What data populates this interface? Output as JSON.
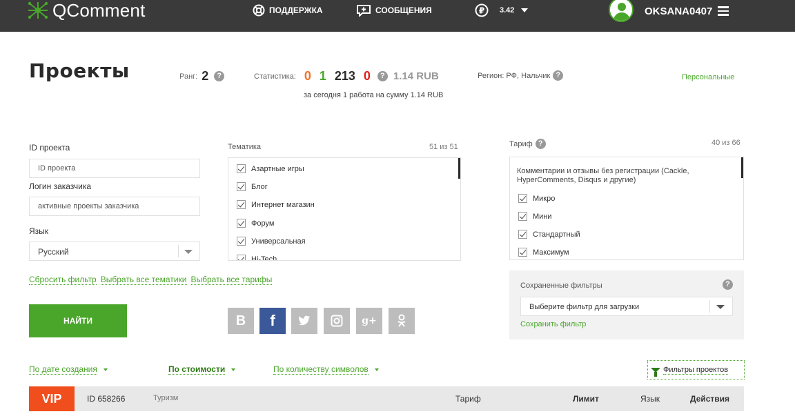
{
  "brand": {
    "name": "QComment"
  },
  "nav": {
    "support": "ПОДДЕРЖКА",
    "messages": "СООБЩЕНИЯ",
    "balance": "3.42"
  },
  "user": {
    "name": "OKSANA0407"
  },
  "header": {
    "title": "Проекты",
    "rank_label": "Ранг:",
    "rank_value": "2",
    "stats_label": "Статистика:",
    "stats": [
      "0",
      "1",
      "213",
      "0"
    ],
    "stats_rub": "1.14 RUB",
    "today": "за сегодня 1 работа на сумму 1.14 RUB",
    "region": "Регион: РФ, Нальчик",
    "personal": "Персональные"
  },
  "filters": {
    "project_id_label": "ID проекта",
    "project_id_placeholder": "ID проекта",
    "customer_label": "Логин заказчика",
    "customer_placeholder": "активные проекты заказчика",
    "lang_label": "Язык",
    "lang_value": "Русский",
    "links": [
      "Сбросить фильтр",
      "Выбрать все тематики",
      "Выбрать все тарифы"
    ],
    "find": "НАЙТИ"
  },
  "topics": {
    "title": "Тематика",
    "count": "51 из 51",
    "items": [
      "Азартные игры",
      "Блог",
      "Интернет магазин",
      "Форум",
      "Универсальная",
      "Hi-Tech"
    ]
  },
  "tariff": {
    "title": "Тариф",
    "count": "40 из 66",
    "group": "Комментарии и отзывы без регистрации (Cackle, HyperComments, Disqus и другие)",
    "items": [
      "Микро",
      "Мини",
      "Стандартный",
      "Максимум"
    ]
  },
  "social": [
    "B",
    "f",
    "t",
    "ig",
    "g+",
    "ok"
  ],
  "saved_filters": {
    "title": "Сохраненные фильтры",
    "select": "Выберите фильтр для загрузки",
    "save": "Сохранить фильтр"
  },
  "sort": {
    "by_date": "По дате создания",
    "by_cost": "По стоимости",
    "by_chars": "По количеству символов",
    "project_filters": "Фильтры проектов"
  },
  "row": {
    "vip": "VIP",
    "id": "ID 658266",
    "topic": "Туризм",
    "tariff": "Тариф",
    "limit": "Лимит",
    "lang": "Язык",
    "actions": "Действия"
  },
  "colors": {
    "accent": "#4aa62a",
    "topbar": "#3a3a3a",
    "vip": "#f04e1c",
    "stat_orange": "#f37021",
    "stat_red": "#e0201b",
    "facebook": "#3b5998"
  }
}
